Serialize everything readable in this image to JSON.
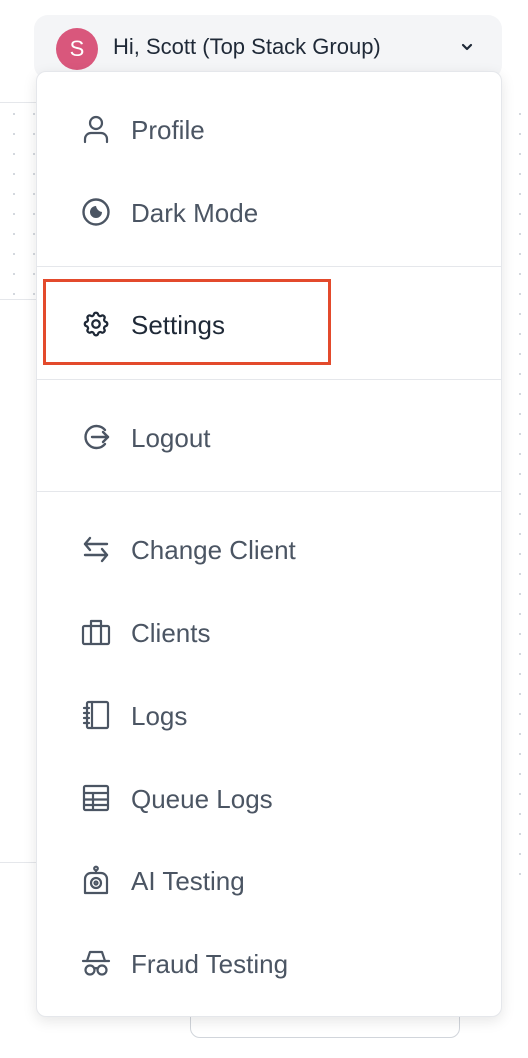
{
  "user_menu": {
    "avatar_initial": "S",
    "greeting": "Hi, Scott (Top Stack Group)"
  },
  "menu": {
    "items": [
      {
        "label": "Profile",
        "icon": "user-icon"
      },
      {
        "label": "Dark Mode",
        "icon": "contrast-icon"
      },
      {
        "label": "Settings",
        "icon": "gear-icon"
      },
      {
        "label": "Logout",
        "icon": "logout-icon"
      },
      {
        "label": "Change Client",
        "icon": "swap-icon"
      },
      {
        "label": "Clients",
        "icon": "briefcase-icon"
      },
      {
        "label": "Logs",
        "icon": "notebook-icon"
      },
      {
        "label": "Queue Logs",
        "icon": "table-icon"
      },
      {
        "label": "AI Testing",
        "icon": "robot-icon"
      },
      {
        "label": "Fraud Testing",
        "icon": "spy-icon"
      }
    ]
  },
  "colors": {
    "avatar": "#d9577c",
    "highlight_border": "#e34a2c",
    "text": "#4b5563"
  }
}
